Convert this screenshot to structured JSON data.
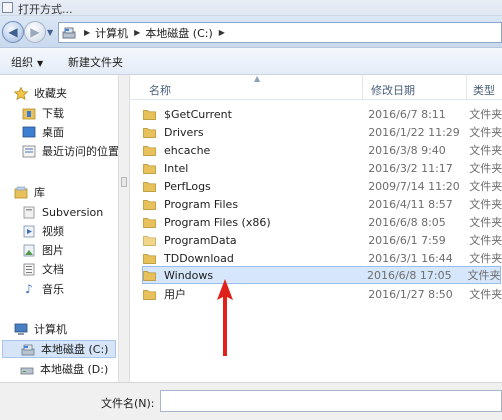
{
  "window": {
    "title": "打开方式..."
  },
  "address": {
    "crumbs": [
      "计算机",
      "本地磁盘 (C:)"
    ]
  },
  "toolbar": {
    "organize_label": "组织",
    "new_folder_label": "新建文件夹"
  },
  "nav": {
    "favorites_header": "收藏夹",
    "favorites": [
      "下载",
      "桌面",
      "最近访问的位置"
    ],
    "libraries_header": "库",
    "libraries": [
      "Subversion",
      "视频",
      "图片",
      "文档",
      "音乐"
    ],
    "computer_header": "计算机",
    "drives": [
      "本地磁盘 (C:)",
      "本地磁盘 (D:)"
    ],
    "selected": "本地磁盘 (C:)"
  },
  "columns": {
    "name": "名称",
    "date": "修改日期",
    "type": "类型"
  },
  "files": [
    {
      "name": "$GetCurrent",
      "date": "2016/6/7 8:11",
      "type": "文件夹"
    },
    {
      "name": "Drivers",
      "date": "2016/1/22 11:29",
      "type": "文件夹"
    },
    {
      "name": "ehcache",
      "date": "2016/3/8 9:40",
      "type": "文件夹"
    },
    {
      "name": "Intel",
      "date": "2016/3/2 11:17",
      "type": "文件夹"
    },
    {
      "name": "PerfLogs",
      "date": "2009/7/14 11:20",
      "type": "文件夹"
    },
    {
      "name": "Program Files",
      "date": "2016/4/11 8:57",
      "type": "文件夹"
    },
    {
      "name": "Program Files (x86)",
      "date": "2016/6/8 8:05",
      "type": "文件夹"
    },
    {
      "name": "ProgramData",
      "date": "2016/6/1 7:59",
      "type": "文件夹"
    },
    {
      "name": "TDDownload",
      "date": "2016/3/1 16:44",
      "type": "文件夹"
    },
    {
      "name": "Windows",
      "date": "2016/6/8 17:05",
      "type": "文件夹"
    },
    {
      "name": "用户",
      "date": "2016/1/27 8:50",
      "type": "文件夹"
    }
  ],
  "selected_file": "Windows",
  "footer": {
    "filename_label": "文件名(N):",
    "filename_value": ""
  },
  "colors": {
    "folder": "#e8c15a",
    "selection": "#d6e7fb",
    "annotation_arrow": "#e0211b"
  },
  "icons": [
    "back-arrow-icon",
    "forward-arrow-icon",
    "drive-icon",
    "star-icon",
    "folder-icon",
    "library-icon",
    "computer-icon",
    "music-icon"
  ]
}
